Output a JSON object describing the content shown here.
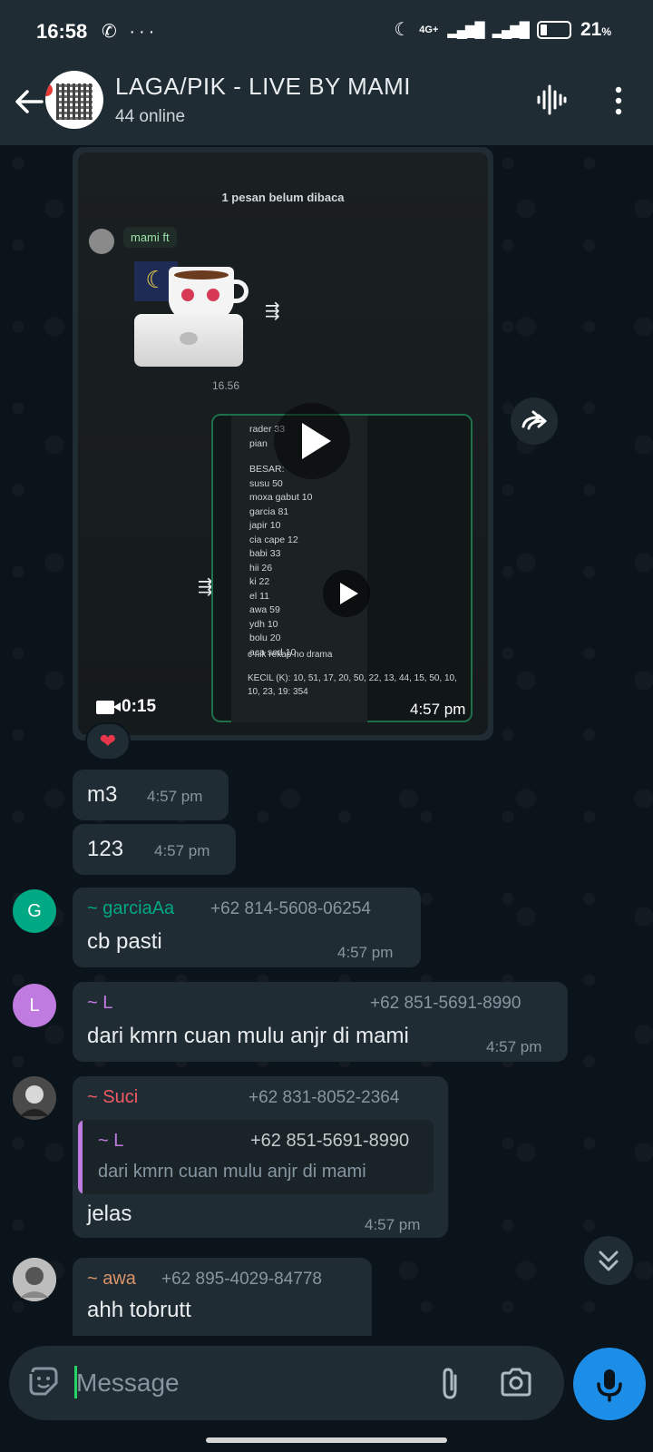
{
  "status_bar": {
    "time": "16:58",
    "left_icons": "✆ ···",
    "network": "4G+",
    "battery_pct": "21",
    "battery_unit": "%"
  },
  "header": {
    "title": "LAGA/PIK - LIVE BY MAMI",
    "subtitle": "44 online"
  },
  "media_message": {
    "inner_unread": "1 pesan belum dibaca",
    "inner_sender": "mami ft",
    "inner_time": "16.56",
    "inner_list_top": "rader 33\npian",
    "inner_list": "BESAR:\nsusu 50\nmoxa gabut 10\ngarcia 81\njapir 10\ncia cape 12\nbabi 33\nhii 26\nki 22\nel 11\nawa 59\nydh 10\nbolu 20\naca sed 10",
    "inner_footer": "c nik rekap no drama",
    "inner_footer2": "KECIL (K): 10, 51, 17, 20, 50, 22, 13, 44, 15, 50, 10, 10, 23, 19: 354",
    "duration": "0:15",
    "time": "4:57 pm",
    "reaction": "❤"
  },
  "messages": [
    {
      "text": "m3",
      "time": "4:57 pm"
    },
    {
      "text": "123",
      "time": "4:57 pm"
    },
    {
      "initial": "G",
      "sender": "~ garciaAa",
      "phone": "+62 814-5608-06254",
      "text": "cb pasti",
      "time": "4:57 pm",
      "color": "#00a884"
    },
    {
      "initial": "L",
      "sender": "~ L",
      "phone": "+62 851-5691-8990",
      "text": "dari kmrn cuan mulu anjr di mami",
      "time": "4:57 pm",
      "color": "#c07be0"
    },
    {
      "sender": "~ Suci",
      "phone": "+62 831-8052-2364",
      "quote_sender": "~ L",
      "quote_phone": "+62 851-5691-8990",
      "quote_text": "dari kmrn cuan mulu anjr di mami",
      "text": "jelas",
      "time": "4:57 pm",
      "color": "#ef5a64"
    },
    {
      "sender": "~ awa",
      "phone": "+62 895-4029-84778",
      "text": "ahh tobrutt",
      "color": "#d9946a"
    }
  ],
  "input": {
    "placeholder": "Message"
  },
  "colors": {
    "accent": "#1d8ee8",
    "background": "#0b141a",
    "bubble": "#202c33"
  }
}
